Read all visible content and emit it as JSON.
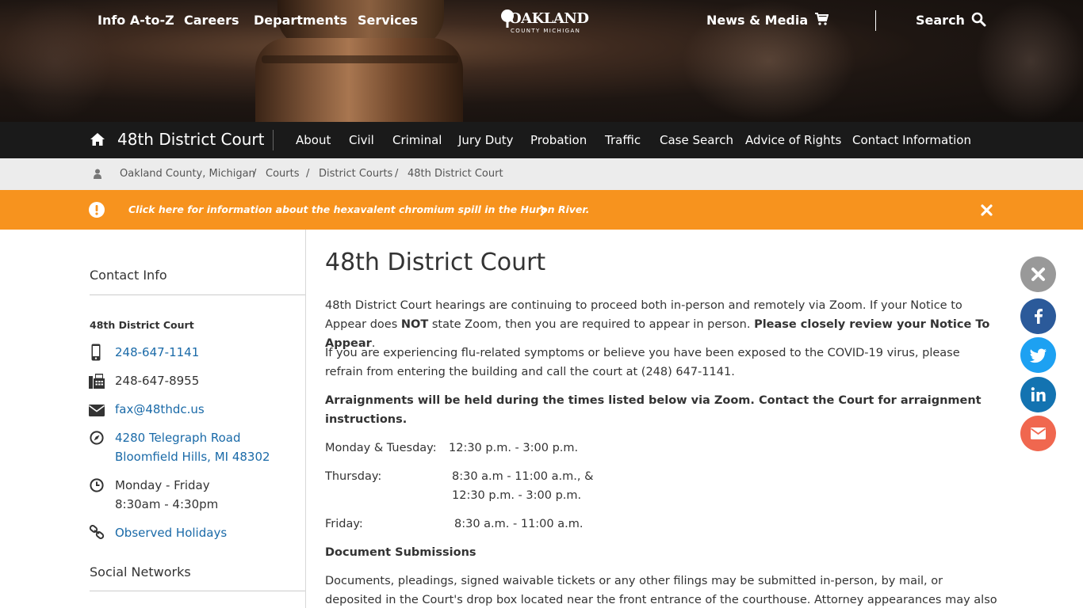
{
  "topnav": {
    "info": "Info A-to-Z",
    "careers": "Careers",
    "departments": "Departments",
    "services": "Services",
    "news": "News & Media",
    "search": "Search",
    "logo_main": "OAKLAND",
    "logo_sub": "COUNTY MICHIGAN"
  },
  "court": {
    "title": "48th District Court",
    "links": [
      "About",
      "Civil",
      "Criminal",
      "Jury Duty",
      "Probation",
      "Traffic",
      "Case Search",
      "Advice of Rights",
      "Contact Information"
    ]
  },
  "breadcrumb": {
    "items": [
      "Oakland County, Michigan",
      "Courts",
      "District Courts",
      "48th District Court"
    ],
    "separator": "/"
  },
  "alert": {
    "message": "Click here for information about the hexavalent chromium spill in the Huron River."
  },
  "sidebar": {
    "contact_heading": "Contact Info",
    "org": "48th District Court",
    "phone": "248-647-1141",
    "fax": "248-647-8955",
    "email": "fax@48thdc.us",
    "address1": "4280 Telegraph Road",
    "address2": "Bloomfield Hills, MI 48302",
    "days": "Monday - Friday",
    "hours": "8:30am - 4:30pm",
    "holidays": "Observed Holidays",
    "social_heading": "Social Networks"
  },
  "main": {
    "title": "48th District Court",
    "p1_a": "48th District Court hearings are continuing to proceed both in-person and remotely via Zoom.  If your Notice to Appear does ",
    "p1_not": "NOT",
    "p1_b": " state Zoom, then you are required to appear in person.  ",
    "p1_bold": "Please closely review your Notice To Appear",
    "p1_end": ".",
    "p2": "If you are experiencing flu-related symptoms or believe you have been exposed to the COVID-19 virus, please refrain from entering the building and call the court at (248) 647-1141.",
    "p3": "Arraignments will be held during the times listed below via Zoom.  Contact the Court for arraignment instructions.",
    "sched_mon_label": "Monday & Tuesday:",
    "sched_mon_time": "12:30 p.m. - 3:00 p.m.",
    "sched_thu_label": "Thursday:",
    "sched_thu_time1": "8:30 a.m - 11:00 a.m., &",
    "sched_thu_time2": "12:30 p.m. - 3:00 p.m.",
    "sched_fri_label": "Friday:",
    "sched_fri_time": "8:30 a.m. - 11:00 a.m.",
    "doc_heading": "Document Submissions",
    "p4": "Documents, pleadings, signed waivable tickets or any other filings may be submitted in-person, by mail, or deposited in the Court's drop box located near the front entrance of the courthouse. Attorney appearances may also be submitted by"
  },
  "colors": {
    "alert": "#f7931e",
    "link": "#1a6aa8",
    "facebook": "#2b5a9a",
    "twitter": "#1da1f2",
    "linkedin": "#1373b1",
    "email": "#f0674f",
    "close": "#999999"
  },
  "icons": [
    "home-icon",
    "cart-icon",
    "search-icon",
    "user-icon",
    "exclamation-icon",
    "chevron-right-icon",
    "close-icon",
    "mobile-phone-icon",
    "fax-icon",
    "envelope-icon",
    "compass-icon",
    "clock-icon",
    "link-icon",
    "facebook-icon",
    "twitter-icon",
    "linkedin-icon"
  ]
}
